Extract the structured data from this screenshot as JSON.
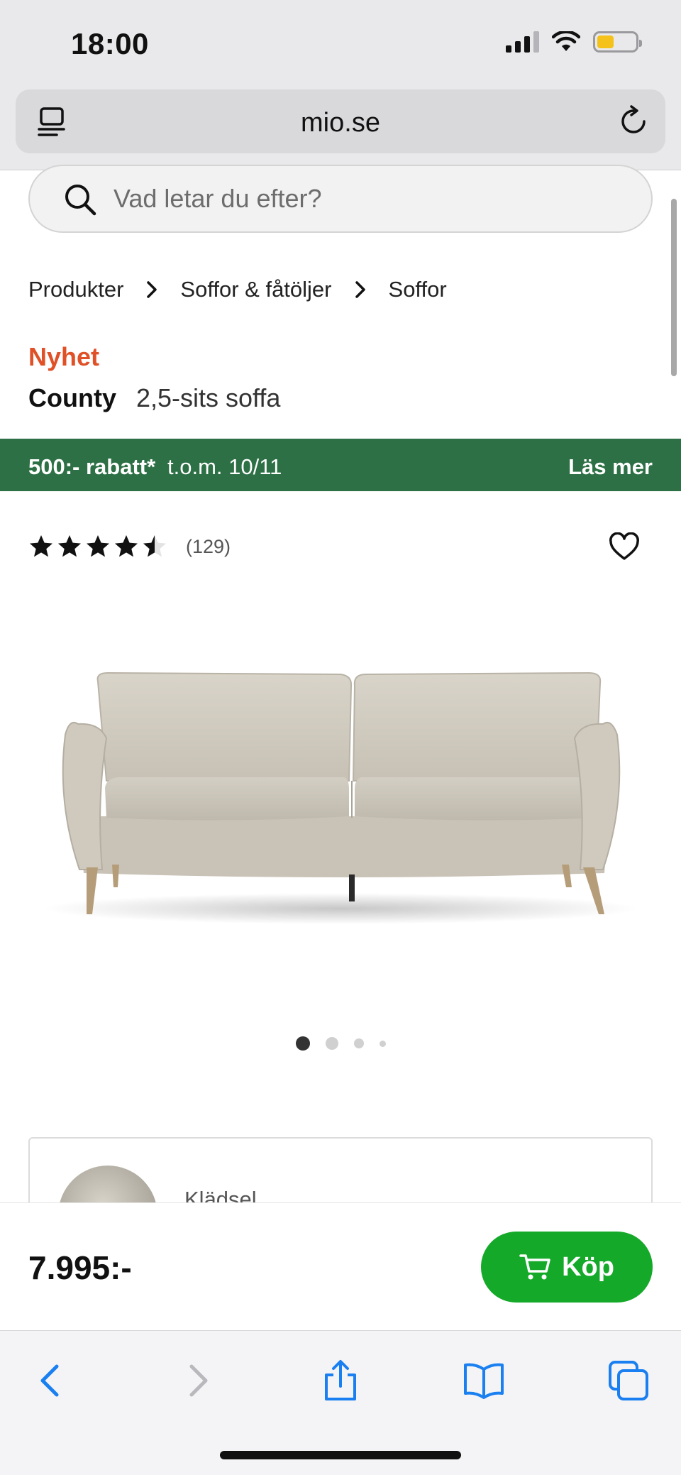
{
  "status_bar": {
    "time": "18:00",
    "battery_level": 0.45
  },
  "browser": {
    "url": "mio.se"
  },
  "search": {
    "placeholder": "Vad letar du efter?"
  },
  "breadcrumb": [
    "Produkter",
    "Soffor & fåtöljer",
    "Soffor"
  ],
  "product": {
    "badge": "Nyhet",
    "name": "County",
    "description": "2,5-sits soffa",
    "rating": 4.5,
    "rating_count": "(129)",
    "price": "7.995:-"
  },
  "promo": {
    "discount": "500:- rabatt*",
    "date": "t.o.m. 10/11",
    "link": "Läs mer"
  },
  "carousel": {
    "total": 4,
    "active": 0
  },
  "options": {
    "upholstery_label": "Klädsel"
  },
  "buy": {
    "label": "Köp"
  },
  "colors": {
    "promo_green": "#2d7045",
    "buy_green": "#15a92a",
    "badge_red": "#e05127",
    "ios_blue": "#1a7ff0"
  }
}
